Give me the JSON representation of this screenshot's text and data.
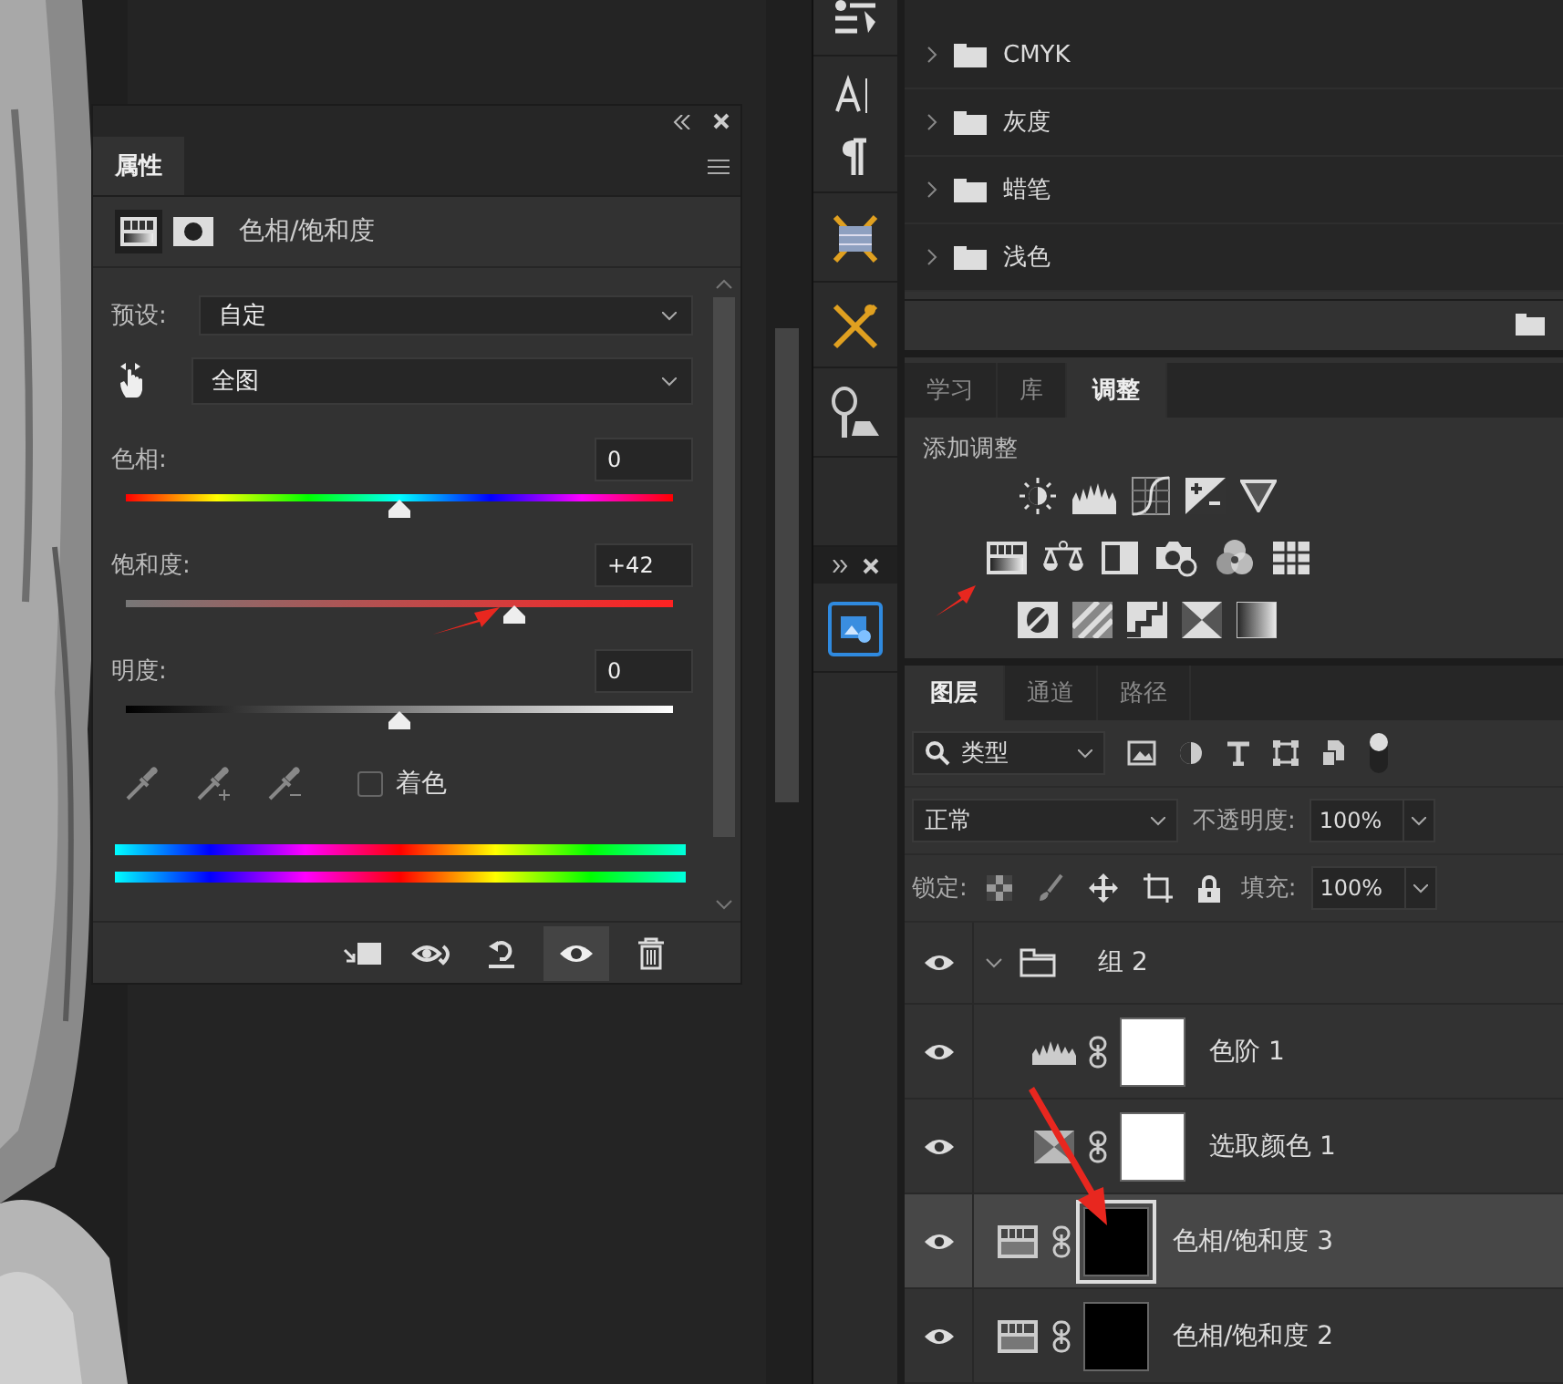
{
  "properties_panel": {
    "tab": "属性",
    "title": "色相/饱和度",
    "preset_label": "预设:",
    "preset_value": "自定",
    "range_value": "全图",
    "sliders": [
      {
        "kind": "hue",
        "label": "色相:",
        "value": "0",
        "level": 0.5
      },
      {
        "kind": "saturation",
        "label": "饱和度:",
        "value": "+42",
        "level": 0.71
      },
      {
        "kind": "lightness",
        "label": "明度:",
        "value": "0",
        "level": 0.5
      }
    ],
    "colorize": {
      "label": "着色",
      "checked": false
    }
  },
  "swatches_panel": {
    "folders": [
      {
        "name": "CMYK"
      },
      {
        "name": "灰度"
      },
      {
        "name": "蜡笔"
      },
      {
        "name": "浅色"
      }
    ]
  },
  "adjustments_tabs": [
    {
      "label": "学习",
      "selected": false
    },
    {
      "label": "库",
      "selected": false
    },
    {
      "label": "调整",
      "selected": true
    }
  ],
  "adjustments_panel": {
    "heading": "添加调整"
  },
  "layers_tabs": [
    {
      "label": "图层",
      "selected": true
    },
    {
      "label": "通道",
      "selected": false
    },
    {
      "label": "路径",
      "selected": false
    }
  ],
  "layers_panel": {
    "filter": "类型",
    "blend_mode": "正常",
    "opacity_label": "不透明度:",
    "opacity": "100%",
    "lock_label": "锁定:",
    "fill_label": "填充:",
    "fill": "100%",
    "layers": [
      {
        "kind": "group",
        "name": "组 2",
        "visible": true,
        "selected": false,
        "expanded": true,
        "children": [
          {
            "kind": "levels",
            "name": "色阶 1",
            "visible": true,
            "selected": false,
            "color": "#ffffff"
          },
          {
            "kind": "selective_color",
            "name": "选取颜色 1",
            "visible": true,
            "selected": false,
            "color": "#ffffff"
          }
        ]
      },
      {
        "kind": "hue_saturation",
        "name": "色相/饱和度 3",
        "visible": true,
        "selected": true,
        "color": "#000000"
      },
      {
        "kind": "hue_saturation",
        "name": "色相/饱和度 2",
        "visible": true,
        "selected": false,
        "color": "#000000"
      }
    ]
  }
}
